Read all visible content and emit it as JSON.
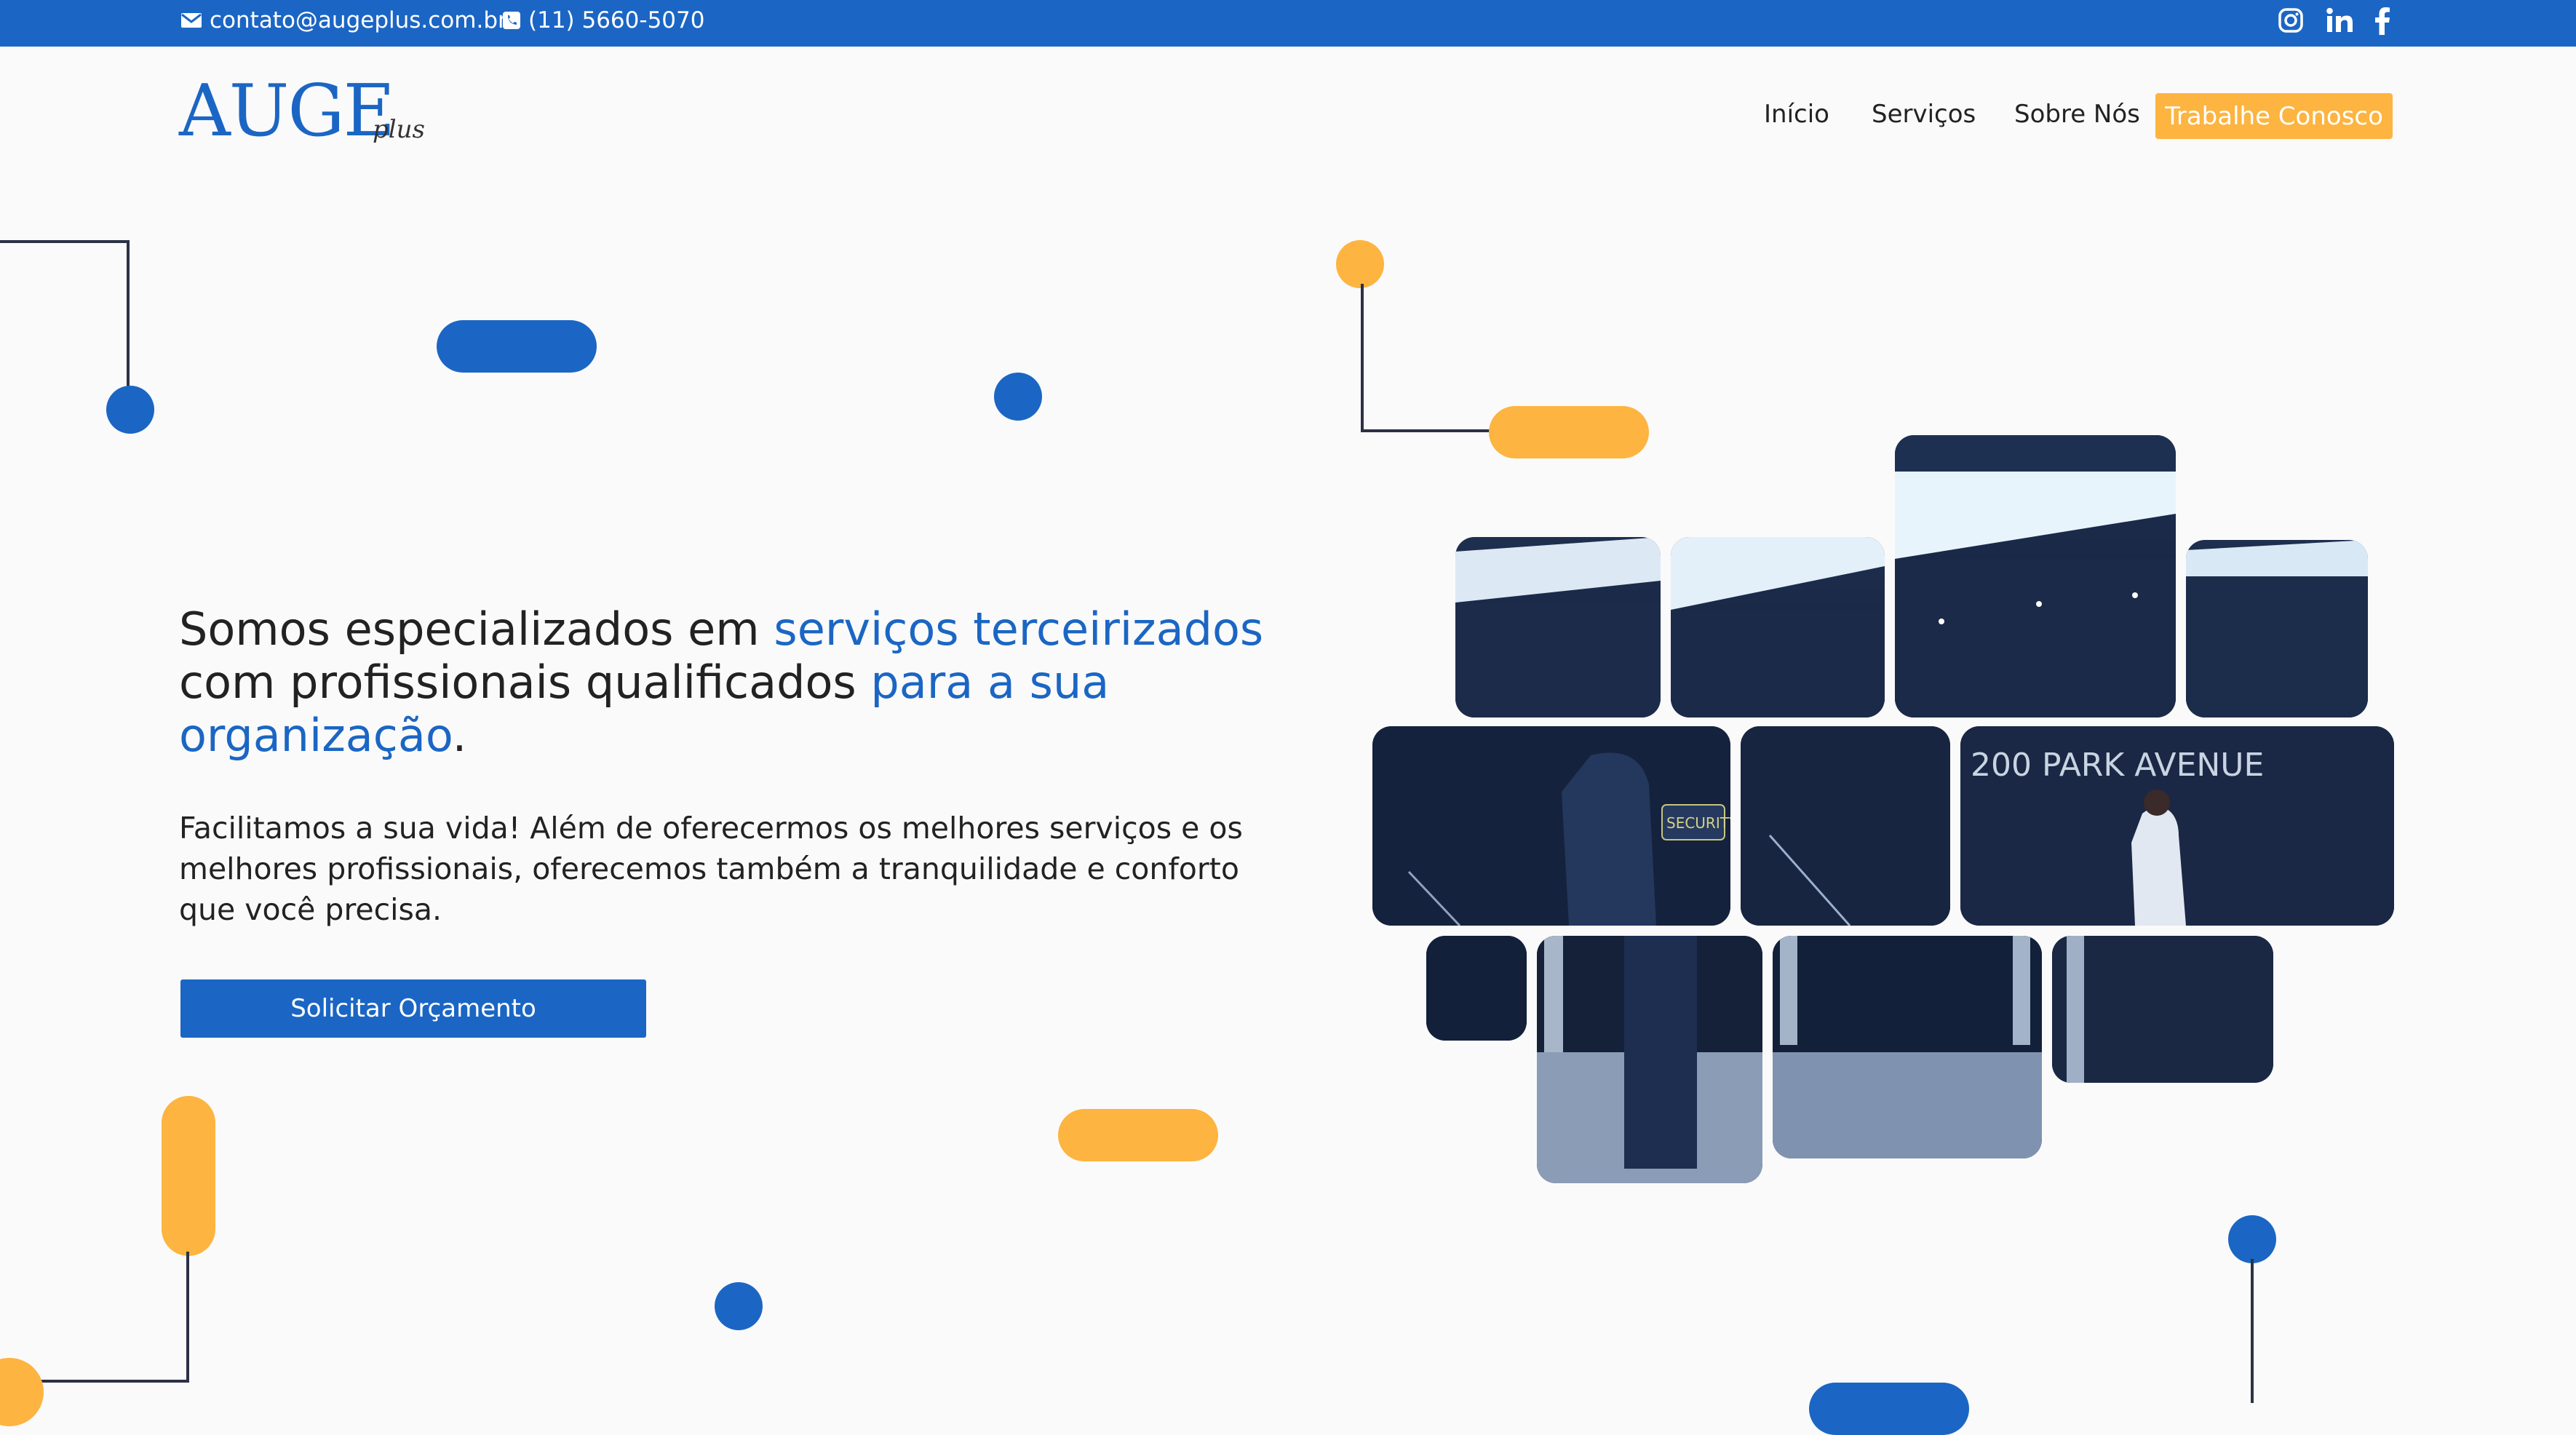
{
  "topbar": {
    "email": "contato@augeplus.com.br",
    "phone": "(11) 5660-5070",
    "social_icons": [
      "instagram-icon",
      "linkedin-icon",
      "facebook-icon"
    ]
  },
  "logo": {
    "main": "AUGE",
    "sub": "plus"
  },
  "nav": {
    "items": [
      "Início",
      "Serviços",
      "Sobre Nós"
    ],
    "cta": "Trabalhe Conosco"
  },
  "hero": {
    "headline_1": "Somos especializados em ",
    "headline_hl_1": "serviços terceirizados",
    "headline_2": " com profissionais qualificados ",
    "headline_hl_2": "para a sua organização",
    "headline_end": ".",
    "subtext": "Facilitamos a sua vida! Além de oferecermos os melhores serviços e os melhores profissionais, oferecemos também a tranquilidade e conforto que você precisa.",
    "cta": "Solicitar Orçamento"
  },
  "image": {
    "sign_text": "200 PARK AVENUE",
    "badge_text": "SECURITY"
  },
  "colors": {
    "primary": "#1b66c4",
    "accent": "#fdb440",
    "line": "#2c3146"
  }
}
